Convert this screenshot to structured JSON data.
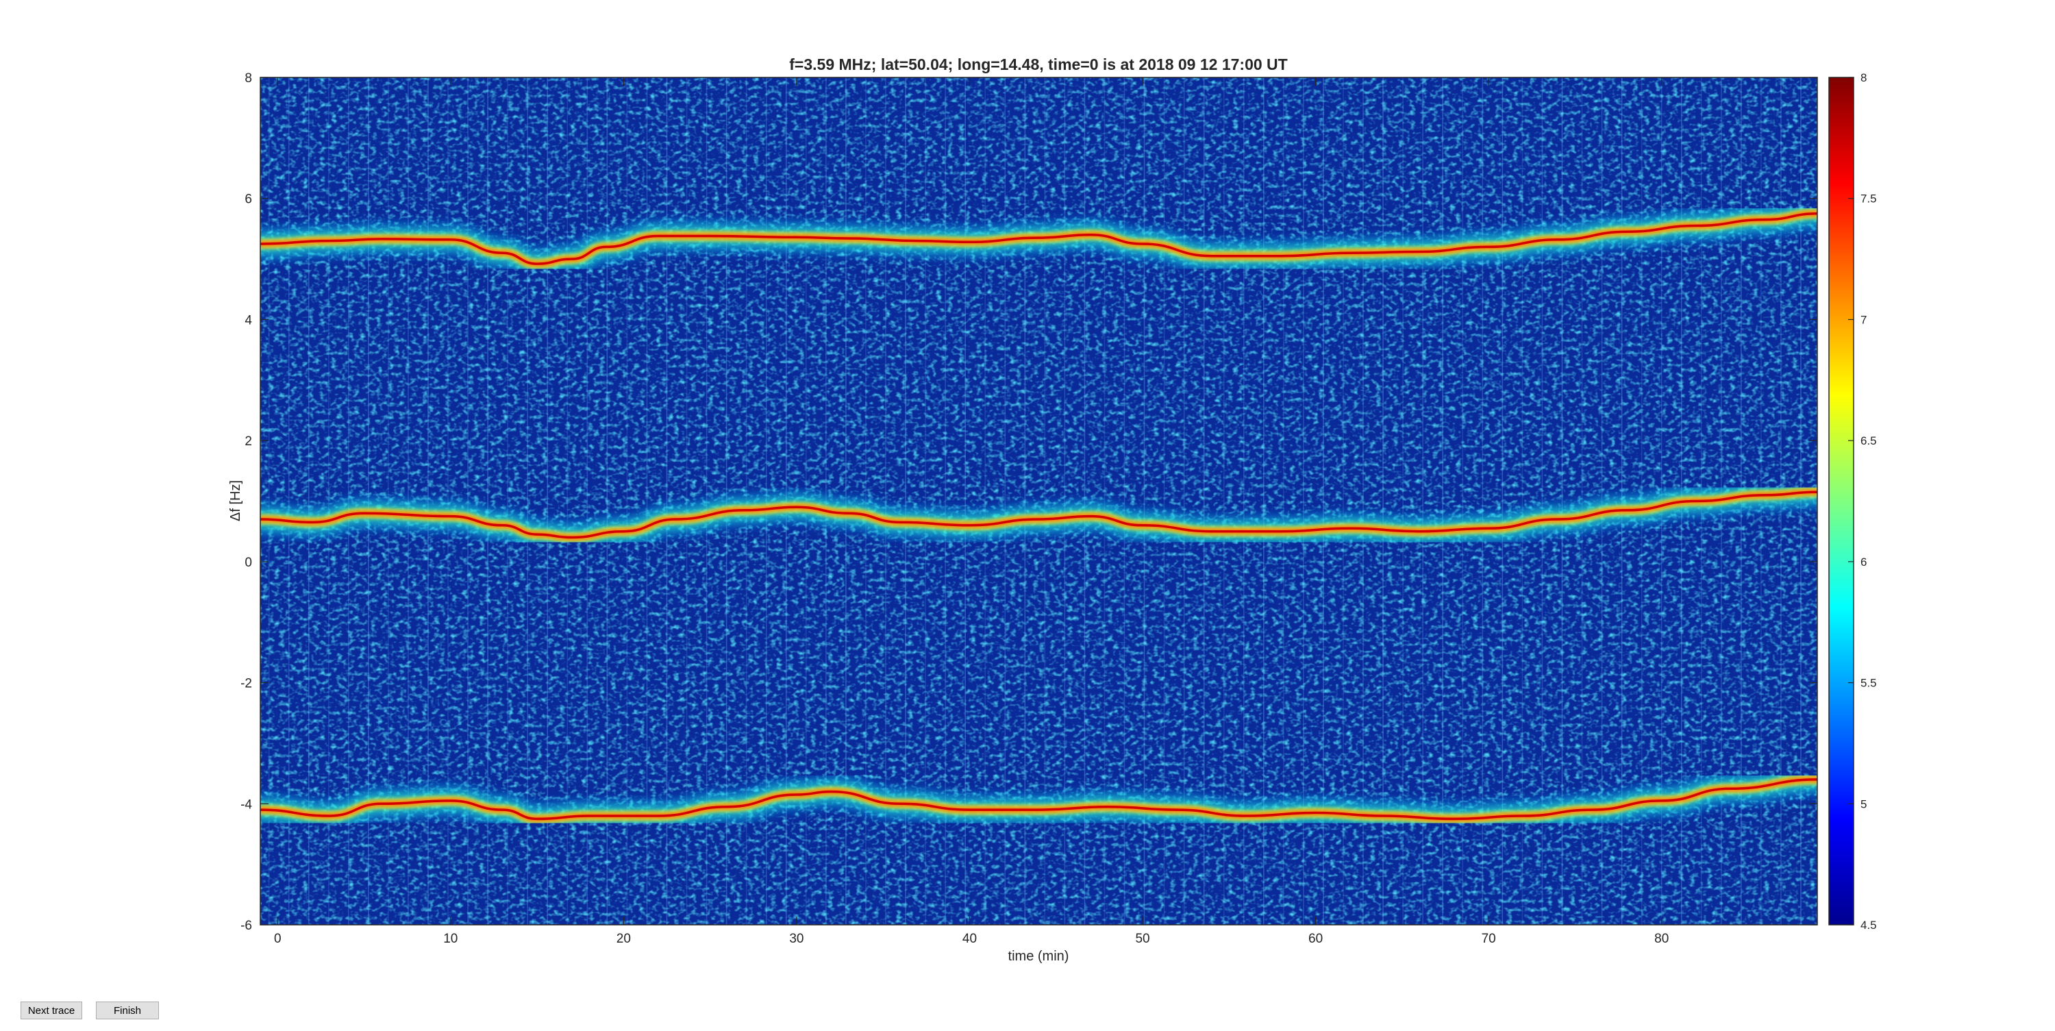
{
  "buttons": {
    "next_trace": "Next trace",
    "finish": "Finish"
  },
  "chart_data": {
    "type": "heatmap",
    "title": "f=3.59 MHz;  lat=50.04; long=14.48, time=0 is at 2018 09 12 17:00 UT",
    "xlabel": "time (min)",
    "ylabel": "Δf [Hz]",
    "xlim": [
      -1,
      89
    ],
    "ylim": [
      -6,
      8
    ],
    "xticks": [
      0,
      10,
      20,
      30,
      40,
      50,
      60,
      70,
      80
    ],
    "yticks": [
      -6,
      -4,
      -2,
      0,
      2,
      4,
      6,
      8
    ],
    "colorbar": {
      "colormap": "jet",
      "clim": [
        4.5,
        8
      ],
      "ticks": [
        4.5,
        5,
        5.5,
        6,
        6.5,
        7,
        7.5,
        8
      ]
    },
    "grid": false,
    "colors": {
      "background": "#0a2a9a",
      "peak": "#d40000"
    },
    "traces": [
      {
        "x": [
          -1,
          3,
          6,
          10,
          13,
          15,
          17,
          19,
          22,
          25,
          30,
          33,
          37,
          40,
          44,
          47,
          50,
          54,
          58,
          62,
          66,
          70,
          74,
          78,
          82,
          86,
          89
        ],
        "y": [
          5.25,
          5.3,
          5.33,
          5.32,
          5.1,
          4.92,
          5.0,
          5.2,
          5.38,
          5.38,
          5.36,
          5.34,
          5.3,
          5.28,
          5.35,
          5.4,
          5.25,
          5.05,
          5.05,
          5.1,
          5.12,
          5.2,
          5.32,
          5.45,
          5.55,
          5.65,
          5.75
        ]
      },
      {
        "x": [
          -1,
          2,
          5,
          10,
          13,
          15,
          17,
          20,
          23,
          27,
          30,
          33,
          36,
          40,
          44,
          47,
          50,
          54,
          58,
          62,
          66,
          70,
          74,
          78,
          82,
          86,
          89
        ],
        "y": [
          0.7,
          0.65,
          0.8,
          0.75,
          0.6,
          0.45,
          0.4,
          0.5,
          0.7,
          0.85,
          0.9,
          0.8,
          0.65,
          0.6,
          0.7,
          0.75,
          0.6,
          0.5,
          0.5,
          0.55,
          0.5,
          0.55,
          0.7,
          0.85,
          1.0,
          1.1,
          1.15
        ]
      },
      {
        "x": [
          -1,
          3,
          6,
          10,
          13,
          15,
          18,
          22,
          26,
          30,
          32,
          36,
          40,
          44,
          48,
          52,
          56,
          60,
          64,
          68,
          72,
          76,
          80,
          84,
          89
        ],
        "y": [
          -4.1,
          -4.2,
          -4.0,
          -3.95,
          -4.1,
          -4.25,
          -4.2,
          -4.2,
          -4.05,
          -3.85,
          -3.8,
          -4.0,
          -4.1,
          -4.1,
          -4.05,
          -4.1,
          -4.2,
          -4.15,
          -4.2,
          -4.25,
          -4.2,
          -4.1,
          -3.95,
          -3.75,
          -3.6
        ]
      }
    ]
  }
}
